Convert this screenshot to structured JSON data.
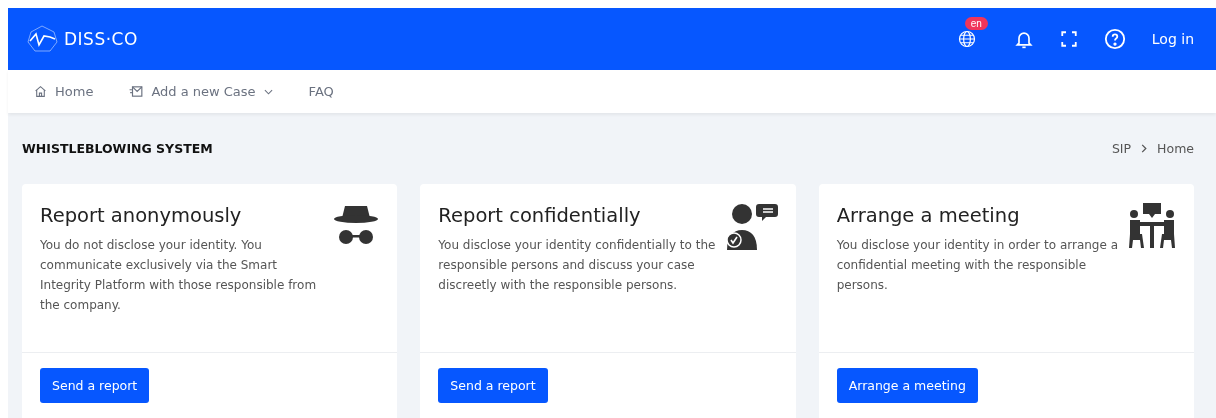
{
  "header": {
    "brand": "DISS·CO",
    "language_badge": "en",
    "login": "Log in"
  },
  "nav": [
    {
      "label": "Home",
      "kind": "home"
    },
    {
      "label": "Add a new Case",
      "kind": "dropdown"
    },
    {
      "label": "FAQ",
      "kind": "plain"
    }
  ],
  "page_title": "WHISTLEBLOWING SYSTEM",
  "breadcrumb": [
    "SIP",
    "Home"
  ],
  "cards": [
    {
      "kind": "anonymous",
      "title": "Report anonymously",
      "text": "You do not disclose your identity. You communicate exclusively via the Smart Integrity Platform with those responsible from the company.",
      "button": "Send a report"
    },
    {
      "kind": "confidential",
      "title": "Report confidentially",
      "text": "You disclose your identity confidentially to the responsible persons and discuss your case discreetly with the responsible persons.",
      "button": "Send a report"
    },
    {
      "kind": "meeting",
      "title": "Arrange a meeting",
      "text": "You disclose your identity in order to arrange a confidential meeting with the responsible persons.",
      "button": "Arrange a meeting"
    }
  ]
}
